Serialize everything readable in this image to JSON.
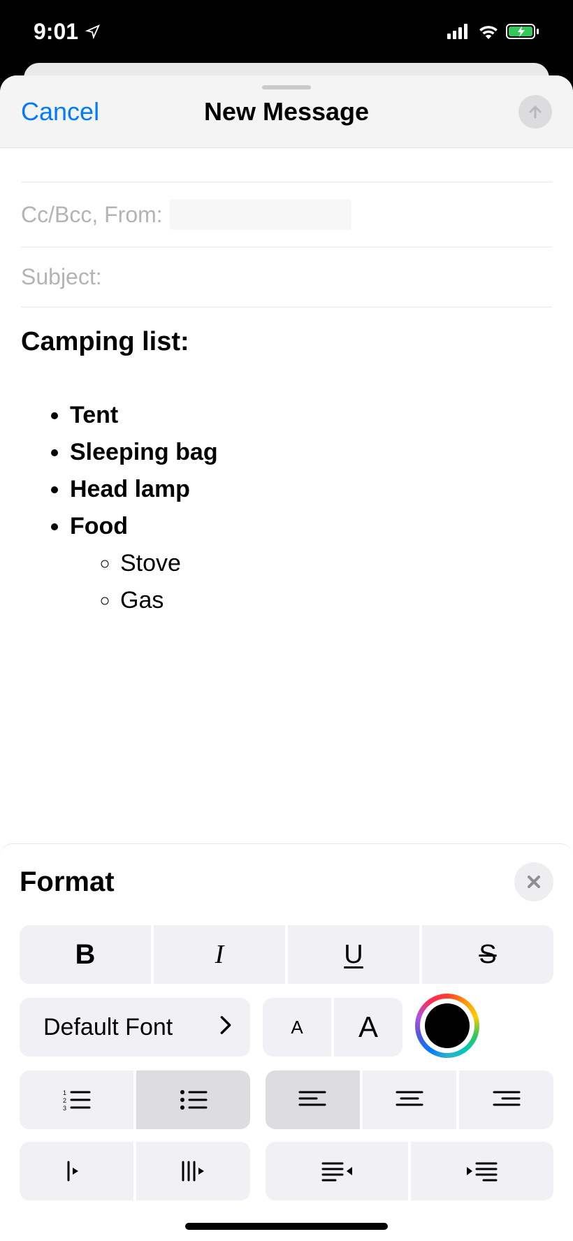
{
  "statusbar": {
    "time": "9:01"
  },
  "sheet": {
    "cancel": "Cancel",
    "title": "New Message",
    "fields": {
      "ccbcc_label": "Cc/Bcc, From:",
      "subject_label": "Subject:"
    },
    "body": {
      "heading": "Camping list:",
      "items": [
        "Tent",
        "Sleeping bag",
        "Head lamp",
        "Food"
      ],
      "sub_items": [
        "Stove",
        "Gas"
      ]
    }
  },
  "format": {
    "title": "Format",
    "buttons": {
      "bold": "B",
      "italic": "I",
      "underline": "U",
      "strike": "S",
      "font_label": "Default Font",
      "small_a": "A",
      "large_a": "A"
    },
    "active_list": "bullet"
  }
}
